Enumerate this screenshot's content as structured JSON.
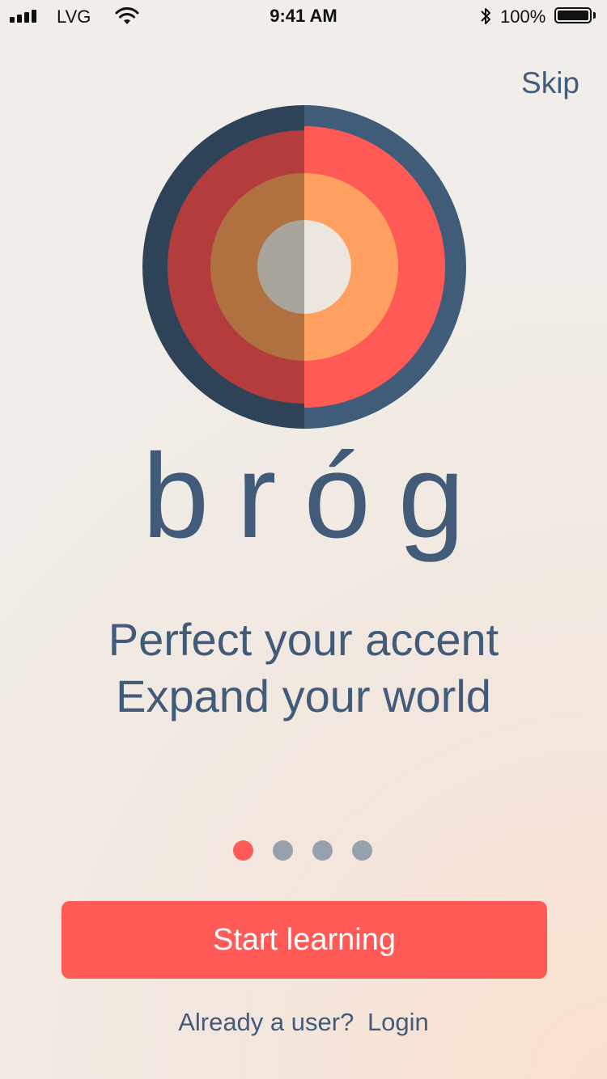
{
  "status_bar": {
    "carrier": "LVG",
    "time": "9:41 AM",
    "battery": "100%",
    "icons": [
      "signal-icon",
      "wifi-icon",
      "bluetooth-icon",
      "battery-icon"
    ]
  },
  "header": {
    "skip_label": "Skip"
  },
  "logo": {
    "name": "bróg",
    "colors": {
      "outer_left": "#2f4358",
      "outer_right": "#415c79",
      "ring2_left": "#b53c3c",
      "ring2_right": "#ff5a55",
      "ring3_left": "#b07040",
      "ring3_right": "#ff9f60",
      "center_left": "#a9a49c",
      "center_right": "#ede6de"
    }
  },
  "tagline": {
    "line1": "Perfect your accent",
    "line2": "Expand your world"
  },
  "pagination": {
    "count": 4,
    "active_index": 0
  },
  "actions": {
    "start_label": "Start learning",
    "already_user": "Already a user?",
    "login_label": "Login"
  },
  "colors": {
    "accent": "#ff5a55",
    "text": "#425b78",
    "dot_inactive": "#97a0ad"
  }
}
